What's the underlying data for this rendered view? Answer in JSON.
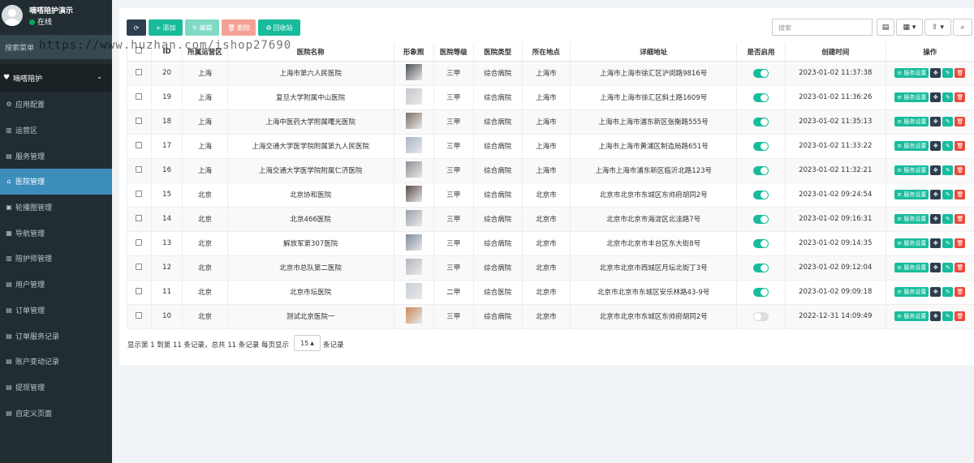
{
  "user": {
    "name": "嘀嗒陪护演示",
    "status": "在线"
  },
  "sidebar": {
    "search_placeholder": "搜索菜单",
    "group_label": "嘀嗒陪护",
    "items": [
      {
        "label": "应用配置",
        "icon": "gear-icon"
      },
      {
        "label": "运营区",
        "icon": "map-icon"
      },
      {
        "label": "服务管理",
        "icon": "list-icon"
      },
      {
        "label": "医院管理",
        "icon": "hospital-icon"
      },
      {
        "label": "轮播图管理",
        "icon": "image-icon"
      },
      {
        "label": "导航管理",
        "icon": "grid-icon"
      },
      {
        "label": "陪护师管理",
        "icon": "table-icon"
      },
      {
        "label": "用户管理",
        "icon": "book-icon"
      },
      {
        "label": "订单管理",
        "icon": "book-icon"
      },
      {
        "label": "订单服务记录",
        "icon": "book-icon"
      },
      {
        "label": "账户变动记录",
        "icon": "book-icon"
      },
      {
        "label": "提现管理",
        "icon": "book-icon"
      },
      {
        "label": "自定义页面",
        "icon": "book-icon"
      }
    ],
    "active_index": 3
  },
  "toolbar": {
    "refresh_icon": "refresh-icon",
    "add_label": "添加",
    "edit_label": "编辑",
    "delete_label": "删除",
    "recycle_label": "回收站",
    "search_placeholder": "搜索"
  },
  "table": {
    "headers": [
      "",
      "ID",
      "所属运营区",
      "医院名称",
      "形象照",
      "医院等级",
      "医院类型",
      "所在地点",
      "详细地址",
      "是否启用",
      "创建时间",
      "操作"
    ],
    "service_label": "服务设置",
    "rows": [
      {
        "id": "20",
        "region": "上海",
        "name": "上海市第六人民医院",
        "level": "三甲",
        "type": "综合病院",
        "city": "上海市",
        "address": "上海市上海市徐汇区沪闵路9816号",
        "enabled": true,
        "created": "2023-01-02 11:37:38",
        "thumb": "#4a4f55"
      },
      {
        "id": "19",
        "region": "上海",
        "name": "复旦大学附属中山医院",
        "level": "三甲",
        "type": "综合病院",
        "city": "上海市",
        "address": "上海市上海市徐汇区斜土路1609号",
        "enabled": true,
        "created": "2023-01-02 11:36:26",
        "thumb": "#c9c5cc"
      },
      {
        "id": "18",
        "region": "上海",
        "name": "上海中医药大学附属曙光医院",
        "level": "三甲",
        "type": "综合病院",
        "city": "上海市",
        "address": "上海市上海市浦东新区张衡路555号",
        "enabled": true,
        "created": "2023-01-02 11:35:13",
        "thumb": "#7d6f66"
      },
      {
        "id": "17",
        "region": "上海",
        "name": "上海交通大学医学院附属第九人民医院",
        "level": "三甲",
        "type": "综合病院",
        "city": "上海市",
        "address": "上海市上海市黄浦区制造局路651号",
        "enabled": true,
        "created": "2023-01-02 11:33:22",
        "thumb": "#a9b4c6"
      },
      {
        "id": "16",
        "region": "上海",
        "name": "上海交通大学医学院附属仁济医院",
        "level": "三甲",
        "type": "综合病院",
        "city": "上海市",
        "address": "上海市上海市浦东新区临沂北路123号",
        "enabled": true,
        "created": "2023-01-02 11:32:21",
        "thumb": "#8c8f94"
      },
      {
        "id": "15",
        "region": "北京",
        "name": "北京协和医院",
        "level": "三甲",
        "type": "综合病院",
        "city": "北京市",
        "address": "北京市北京市东城区东帅府胡同2号",
        "enabled": true,
        "created": "2023-01-02 09:24:54",
        "thumb": "#5a4a45"
      },
      {
        "id": "14",
        "region": "北京",
        "name": "北京466医院",
        "level": "三甲",
        "type": "综合病院",
        "city": "北京市",
        "address": "北京市北京市海淀区北洼路7号",
        "enabled": true,
        "created": "2023-01-02 09:16:31",
        "thumb": "#9aa1ab"
      },
      {
        "id": "13",
        "region": "北京",
        "name": "解放军第307医院",
        "level": "三甲",
        "type": "综合病院",
        "city": "北京市",
        "address": "北京市北京市丰台区东大街8号",
        "enabled": true,
        "created": "2023-01-02 09:14:35",
        "thumb": "#7e8b9c"
      },
      {
        "id": "12",
        "region": "北京",
        "name": "北京市总队第二医院",
        "level": "三甲",
        "type": "综合病院",
        "city": "北京市",
        "address": "北京市北京市西城区月坛北街丁3号",
        "enabled": true,
        "created": "2023-01-02 09:12:04",
        "thumb": "#b3b7bd"
      },
      {
        "id": "11",
        "region": "北京",
        "name": "北京市坛医院",
        "level": "二甲",
        "type": "综合医院",
        "city": "北京市",
        "address": "北京市北京市东城区安乐林路43-9号",
        "enabled": true,
        "created": "2023-01-02 09:09:18",
        "thumb": "#c6cfd8"
      },
      {
        "id": "10",
        "region": "北京",
        "name": "测试北京医院一",
        "level": "三甲",
        "type": "综合病院",
        "city": "北京市",
        "address": "北京市北京市东城区东帅府胡同2号",
        "enabled": false,
        "created": "2022-12-31 14:09:49",
        "thumb": "#c98a5a"
      }
    ]
  },
  "pager": {
    "summary": "显示第 1 到第 11 条记录，总共 11 条记录 每页显示",
    "page_size": "15",
    "suffix": "条记录"
  },
  "watermark": "https://www.huzhan.com/ishop27690"
}
